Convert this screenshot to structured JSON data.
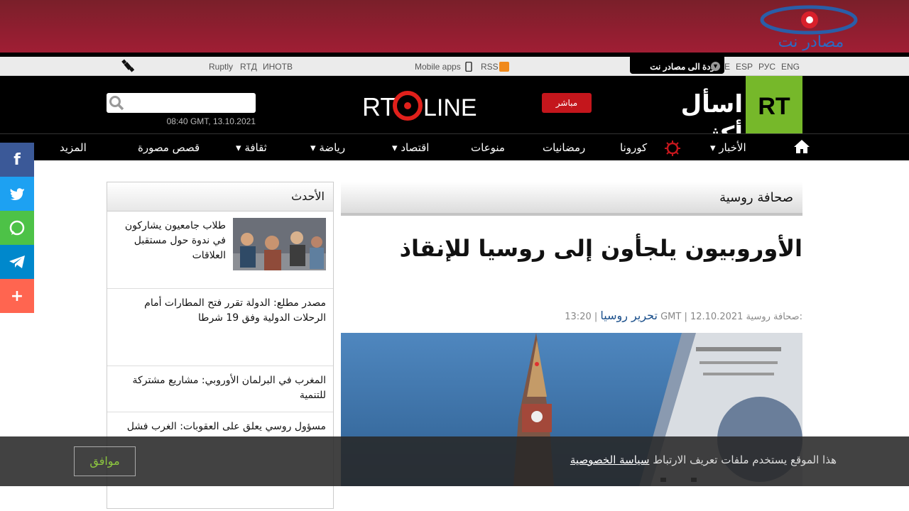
{
  "banner": {
    "logo_text": "مصادر نت"
  },
  "topbar": {
    "links_left": [
      "Ruptly",
      "RTД",
      "ИНОТВ"
    ],
    "mobile_apps": "Mobile apps",
    "rss": "RSS",
    "back_label": "عودة الى مصادر نت",
    "languages": [
      "E",
      "ESP",
      "РУС",
      "ENG"
    ]
  },
  "header": {
    "datetime": "08:40 GMT, 13.10.2021",
    "live_label": "مباشر",
    "slogan": "اسأل أكثر",
    "logo_text": "RT",
    "brand": "RTONLINE"
  },
  "nav": {
    "items": [
      "المزيد",
      "قصص مصورة",
      "ثقافة",
      "رياضة",
      "اقتصاد",
      "منوعات",
      "رمضانيات",
      "كورونا",
      "الأخبار"
    ]
  },
  "share": [
    "f",
    "twitter",
    "whatsapp",
    "telegram",
    "+"
  ],
  "article": {
    "section": "صحافة روسية",
    "headline": "الأوروبيون يلجأون إلى روسيا للإنقاذ",
    "author_prefix": "صحافة روسية:",
    "author": "تحرير روسيا",
    "date": "12.10.2021",
    "time": "13:20 GMT"
  },
  "sidebar": {
    "title": "الأحدث",
    "items": [
      "طلاب جامعيون يشاركون في ندوة حول مستقبل العلاقات",
      "مصدر مطلع: الدولة تقرر فتح المطارات أمام الرحلات الدولية وفق 19 شرطا",
      "المغرب في البرلمان الأوروبي: مشاريع مشتركة للتنمية",
      "مسؤول روسي يعلق على العقوبات: الغرب فشل"
    ]
  },
  "cookie": {
    "accept": "موافق",
    "text": "هذا الموقع يستخدم ملفات تعريف الارتباط",
    "link": "سياسة الخصوصية"
  }
}
